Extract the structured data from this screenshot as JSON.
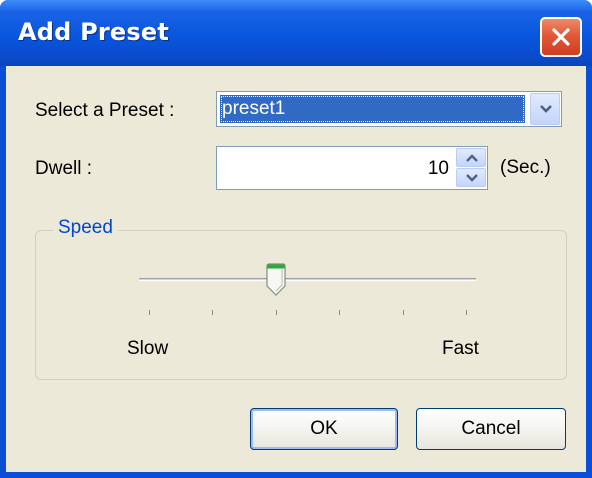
{
  "window": {
    "title": "Add Preset"
  },
  "preset": {
    "label": "Select a Preset :",
    "value": "preset1"
  },
  "dwell": {
    "label": "Dwell :",
    "value": "10",
    "unit": "(Sec.)"
  },
  "speed": {
    "group_title": "Speed",
    "min_label": "Slow",
    "max_label": "Fast",
    "level_fraction": 0.4,
    "tick_count": 6
  },
  "buttons": {
    "ok": "OK",
    "cancel": "Cancel"
  },
  "colors": {
    "titlebar": "#0856dd",
    "close": "#e2593a",
    "selection": "#316ac5",
    "group_title": "#0046d5",
    "dialog_bg": "#ece9d8"
  },
  "icons": {
    "close": "close-icon",
    "dropdown": "chevron-down-icon",
    "spin_up": "spin-up-icon",
    "spin_down": "spin-down-icon"
  }
}
